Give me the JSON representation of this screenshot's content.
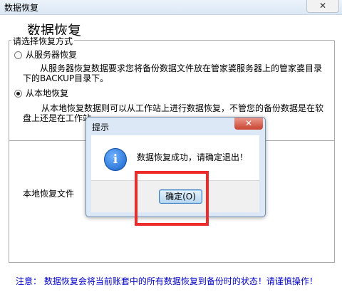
{
  "window": {
    "title": "数据恢复",
    "close_label": "✕"
  },
  "page": {
    "heading": "数据恢复"
  },
  "method_group": {
    "legend": "请选择恢复方式",
    "options": [
      {
        "label": "从服务器恢复",
        "selected": false,
        "desc_line1": "从服务器恢复数据要求您将备份数据文件放在管家婆服务器上的管家婆目录",
        "desc_line2": "下的BACKUP目录下。"
      },
      {
        "label": "从本地恢复",
        "selected": true,
        "desc_line1": "从本地恢复数据则可以从工作站上进行数据恢复，不管您的备份数据是在软",
        "desc_line2": "盘上还是在工作站"
      }
    ]
  },
  "local_panel": {
    "label": "本地恢复文件"
  },
  "note": "注意： 数据恢复会将当前账套中的所有数据恢复到备份时的状态！请谨慎操作！",
  "dialog": {
    "title": "提示",
    "message": "数据恢复成功，请确定退出！",
    "ok_label": "确定(O)",
    "close_label": "✕",
    "icon": "info-icon"
  },
  "highlight_color": "#ee2b2b"
}
